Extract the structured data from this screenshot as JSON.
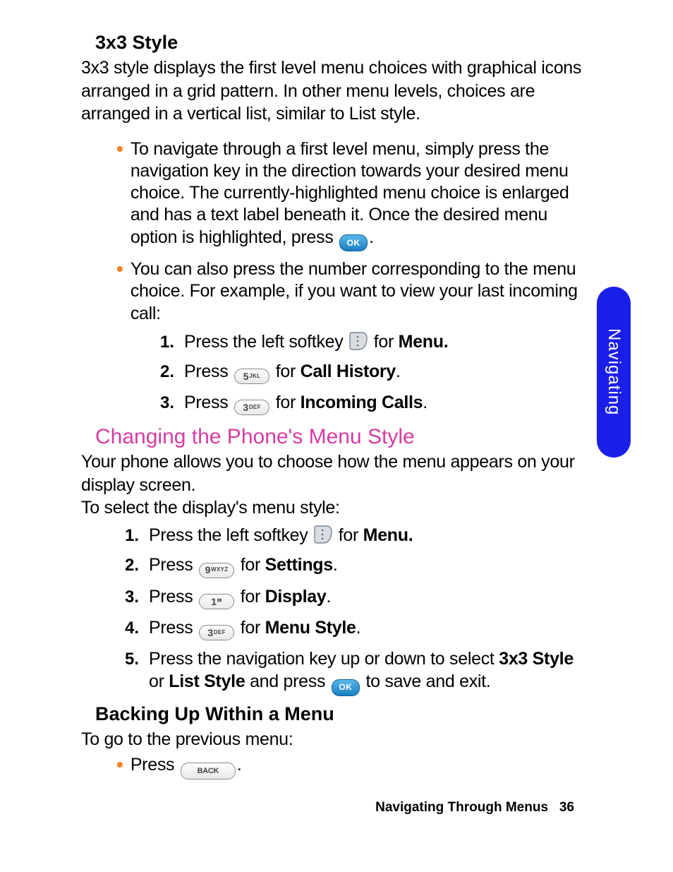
{
  "sideTab": "Navigating",
  "footer": {
    "title": "Navigating Through Menus",
    "page": "36"
  },
  "sections": {
    "s1": {
      "title": "3x3 Style",
      "intro": "3x3 style displays the first level menu choices with graphical icons arranged in a grid pattern. In other menu levels, choices are arranged in a vertical list, similar to List style.",
      "bullet1a": "To navigate through a first level menu, simply press the navigation key in the direction towards your desired menu choice. The currently-highlighted menu choice is enlarged and has a text label beneath it. Once the desired menu option is highlighted, press ",
      "bullet1b": ".",
      "bullet2": "You can also press the number corresponding to the menu choice. For example, if you want to view your last incoming call:",
      "steps": {
        "s1a": "Press the left softkey ",
        "s1b": " for ",
        "s1c": "Menu.",
        "s2a": "Press ",
        "s2b": " for ",
        "s2c": "Call History",
        "s2d": ".",
        "s3a": "Press ",
        "s3b": " for ",
        "s3c": "Incoming Calls",
        "s3d": "."
      }
    },
    "s2": {
      "title": "Changing the Phone's Menu Style",
      "p1": "Your phone allows you to choose how the menu appears on your display screen.",
      "p2": "To select the display's menu style:",
      "steps": {
        "s1a": "Press the left softkey ",
        "s1b": " for ",
        "s1c": "Menu.",
        "s2a": "Press ",
        "s2b": " for ",
        "s2c": "Settings",
        "s2d": ".",
        "s3a": "Press ",
        "s3b": " for ",
        "s3c": "Display",
        "s3d": ".",
        "s4a": "Press  ",
        "s4b": " for ",
        "s4c": "Menu Style",
        "s4d": ".",
        "s5a": "Press the navigation key up or down to select ",
        "s5b": "3x3 Style",
        "s5c": " or ",
        "s5d": "List Style",
        "s5e": " and press ",
        "s5f": " to save and exit."
      }
    },
    "s3": {
      "title": "Backing Up Within a Menu",
      "p1": "To go to the previous menu:",
      "bullet1a": "Press ",
      "bullet1b": "."
    }
  },
  "keys": {
    "ok": "OK",
    "back": "BACK",
    "k5": {
      "digit": "5",
      "label": "JKL"
    },
    "k3": {
      "digit": "3",
      "label": "DEF"
    },
    "k9": {
      "digit": "9",
      "label": "WXYZ"
    },
    "k1": {
      "digit": "1",
      "label": ""
    }
  }
}
